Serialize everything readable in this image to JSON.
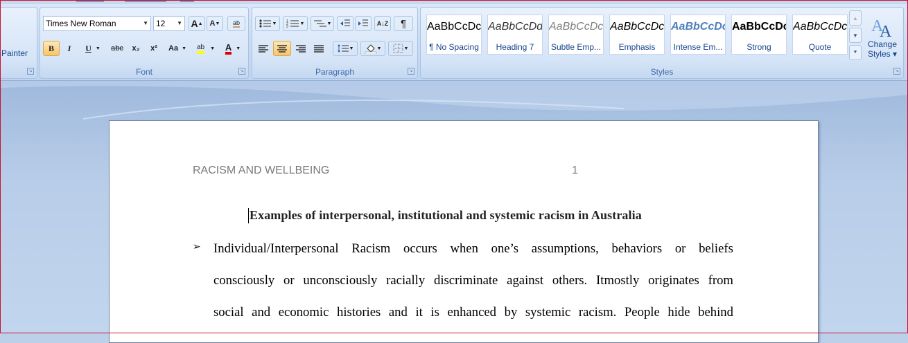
{
  "ribbon": {
    "clipboard": {
      "format_painter_label": "Painter"
    },
    "font": {
      "group_label": "Font",
      "font_name": "Times New Roman",
      "font_size": "12",
      "grow_glyph": "A",
      "shrink_glyph": "A",
      "clear_glyph": "ab",
      "bold_glyph": "B",
      "italic_glyph": "I",
      "underline_glyph": "U",
      "strike_glyph": "abc",
      "subscript_glyph": "x₂",
      "superscript_glyph": "x²",
      "case_glyph": "Aa",
      "highlight_glyph": "ab",
      "fontcolor_glyph": "A"
    },
    "paragraph": {
      "group_label": "Paragraph",
      "show_marks_glyph": "¶"
    },
    "styles": {
      "group_label": "Styles",
      "items": [
        {
          "sample": "AaBbCcDc",
          "name": "¶ No Spacing"
        },
        {
          "sample": "AaBbCcDd",
          "name": "Heading 7"
        },
        {
          "sample": "AaBbCcDc",
          "name": "Subtle Emp..."
        },
        {
          "sample": "AaBbCcDc",
          "name": "Emphasis"
        },
        {
          "sample": "AaBbCcDc",
          "name": "Intense Em..."
        },
        {
          "sample": "AaBbCcDc",
          "name": "Strong"
        },
        {
          "sample": "AaBbCcDc",
          "name": "Quote"
        }
      ],
      "change_styles_line1": "Change",
      "change_styles_line2": "Styles ▾"
    }
  },
  "document": {
    "header_left": "RACISM AND WELLBEING",
    "page_number": "1",
    "title": "Examples of interpersonal, institutional and systemic racism in Australia",
    "bullet_glyph": "➢",
    "lines": [
      "Individual/Interpersonal Racism occurs when one’s assumptions, behaviors or beliefs",
      "consciously or unconsciously racially discriminate against others. Itmostly originates from",
      "social and economic histories and it is enhanced by systemic racism. People hide behind"
    ]
  },
  "colors": {
    "ribbon_bg": "#c7daf2",
    "doc_bg": "#b8cde8",
    "highlight_yellow": "#ffff00",
    "font_red": "#e00000",
    "active_orange": "#f9c46b"
  }
}
